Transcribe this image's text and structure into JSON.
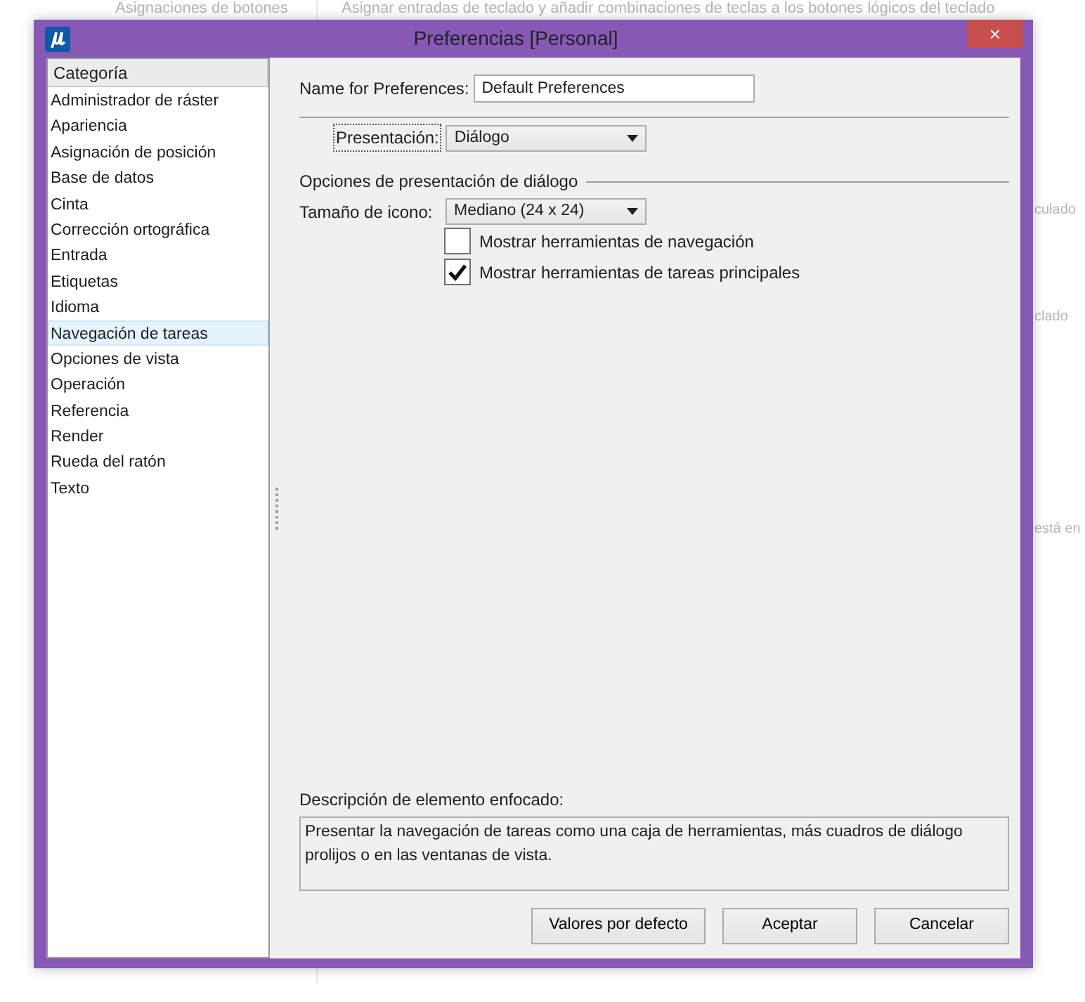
{
  "background": {
    "sidebar_item": "Asignaciones de botones",
    "header_text": "Asignar entradas de teclado y añadir combinaciones de teclas a los botones lógicos del teclado",
    "fragments": [
      "culado",
      "clado",
      "está en"
    ]
  },
  "window": {
    "title": "Preferencias [Personal]",
    "close": "×"
  },
  "category_list": {
    "header": "Categoría",
    "items": [
      {
        "label": "Administrador de ráster",
        "selected": false
      },
      {
        "label": "Apariencia",
        "selected": false
      },
      {
        "label": "Asignación de posición",
        "selected": false
      },
      {
        "label": "Base de datos",
        "selected": false
      },
      {
        "label": "Cinta",
        "selected": false
      },
      {
        "label": "Corrección ortográfica",
        "selected": false
      },
      {
        "label": "Entrada",
        "selected": false
      },
      {
        "label": "Etiquetas",
        "selected": false
      },
      {
        "label": "Idioma",
        "selected": false
      },
      {
        "label": "Navegación de tareas",
        "selected": true
      },
      {
        "label": "Opciones de vista",
        "selected": false
      },
      {
        "label": "Operación",
        "selected": false
      },
      {
        "label": "Referencia",
        "selected": false
      },
      {
        "label": "Render",
        "selected": false
      },
      {
        "label": "Rueda del ratón",
        "selected": false
      },
      {
        "label": "Texto",
        "selected": false
      }
    ]
  },
  "name_field": {
    "label": "Name for Preferences:",
    "value": "Default Preferences"
  },
  "presentation": {
    "label": "Presentación:",
    "value": "Diálogo"
  },
  "dialog_options": {
    "heading": "Opciones de presentación de diálogo",
    "icon_size": {
      "label": "Tamaño de icono:",
      "value": "Mediano (24 x 24)"
    },
    "checkboxes": [
      {
        "label": "Mostrar herramientas de navegación",
        "checked": false
      },
      {
        "label": "Mostrar herramientas de tareas principales",
        "checked": true
      }
    ]
  },
  "description": {
    "label": "Descripción de elemento enfocado:",
    "text": "Presentar la navegación de tareas como una caja de herramientas, más cuadros de diálogo prolijos o en las ventanas de vista."
  },
  "buttons": [
    "Valores por defecto",
    "Aceptar",
    "Cancelar"
  ]
}
